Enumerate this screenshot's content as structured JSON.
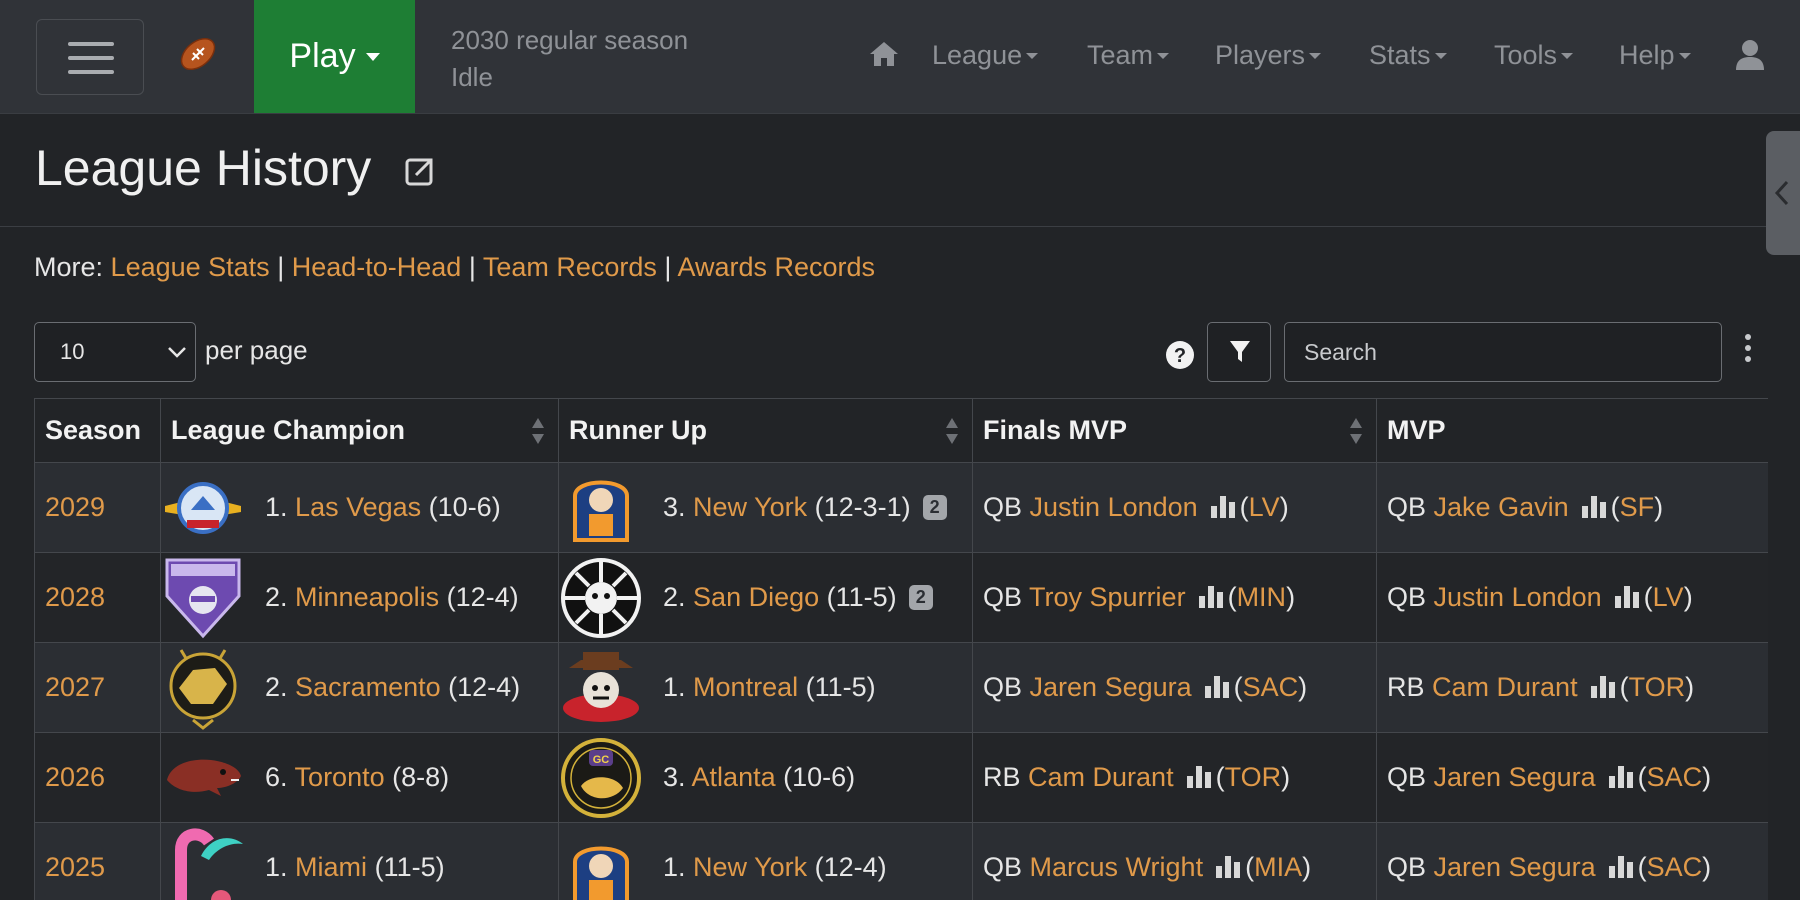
{
  "nav": {
    "play_label": "Play",
    "season_phase": "2030 regular season",
    "status": "Idle",
    "menus": [
      "League",
      "Team",
      "Players",
      "Stats",
      "Tools",
      "Help"
    ]
  },
  "page": {
    "title": "League History",
    "more_label": "More:",
    "more_links": [
      "League Stats",
      "Head-to-Head",
      "Team Records",
      "Awards Records"
    ]
  },
  "controls": {
    "per_page_value": "10",
    "per_page_label": "per page",
    "search_placeholder": "Search"
  },
  "table": {
    "headers": [
      "Season",
      "League Champion",
      "Runner Up",
      "Finals MVP",
      "MVP"
    ],
    "rows": [
      {
        "season": "2029",
        "champ_seed": "1.",
        "champ_team": "Las Vegas",
        "champ_record": "(10-6)",
        "runner_seed": "3.",
        "runner_team": "New York",
        "runner_record": "(12-3-1)",
        "runner_badge": "2",
        "fmvp_pos": "QB",
        "fmvp_name": "Justin London",
        "fmvp_team": "LV",
        "mvp_pos": "QB",
        "mvp_name": "Jake Gavin",
        "mvp_team": "SF"
      },
      {
        "season": "2028",
        "champ_seed": "2.",
        "champ_team": "Minneapolis",
        "champ_record": "(12-4)",
        "runner_seed": "2.",
        "runner_team": "San Diego",
        "runner_record": "(11-5)",
        "runner_badge": "2",
        "fmvp_pos": "QB",
        "fmvp_name": "Troy Spurrier",
        "fmvp_team": "MIN",
        "mvp_pos": "QB",
        "mvp_name": "Justin London",
        "mvp_team": "LV"
      },
      {
        "season": "2027",
        "champ_seed": "2.",
        "champ_team": "Sacramento",
        "champ_record": "(12-4)",
        "runner_seed": "1.",
        "runner_team": "Montreal",
        "runner_record": "(11-5)",
        "fmvp_pos": "QB",
        "fmvp_name": "Jaren Segura",
        "fmvp_team": "SAC",
        "mvp_pos": "RB",
        "mvp_name": "Cam Durant",
        "mvp_team": "TOR"
      },
      {
        "season": "2026",
        "champ_seed": "6.",
        "champ_team": "Toronto",
        "champ_record": "(8-8)",
        "runner_seed": "3.",
        "runner_team": "Atlanta",
        "runner_record": "(10-6)",
        "fmvp_pos": "RB",
        "fmvp_name": "Cam Durant",
        "fmvp_team": "TOR",
        "mvp_pos": "QB",
        "mvp_name": "Jaren Segura",
        "mvp_team": "SAC"
      },
      {
        "season": "2025",
        "champ_seed": "1.",
        "champ_team": "Miami",
        "champ_record": "(11-5)",
        "runner_seed": "1.",
        "runner_team": "New York",
        "runner_record": "(12-4)",
        "fmvp_pos": "QB",
        "fmvp_name": "Marcus Wright",
        "fmvp_team": "MIA",
        "mvp_pos": "QB",
        "mvp_name": "Jaren Segura",
        "mvp_team": "SAC"
      }
    ]
  },
  "colors": {
    "link": "#e09a4a",
    "play_button": "#1e7e34",
    "navbar": "#303338",
    "background": "#222427"
  }
}
